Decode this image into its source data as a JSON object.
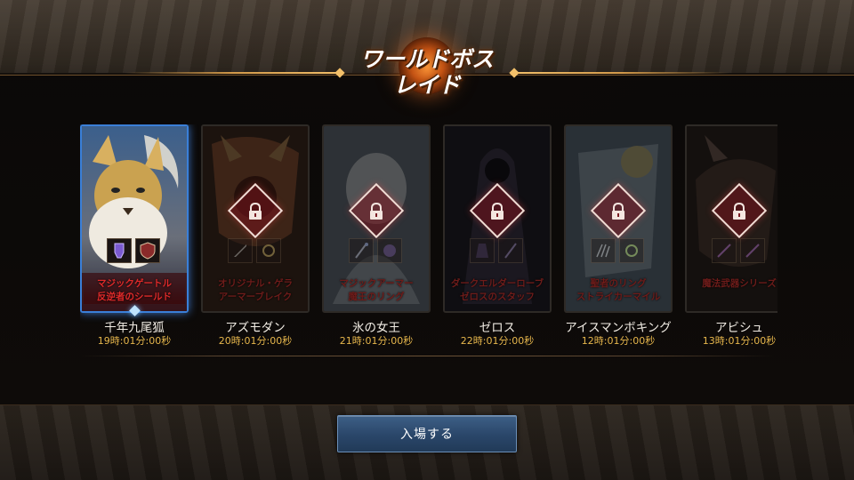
{
  "title": {
    "line1": "ワールドボス",
    "line2": "レイド"
  },
  "bosses": [
    {
      "name": "千年九尾狐",
      "time": "19時:01分:00秒",
      "reward_line1": "マジックゲートル",
      "reward_line2": "反逆者のシールド",
      "locked": false,
      "selected": true,
      "art_color": "#c9a45a",
      "slot_icons": [
        "gauntlet-icon",
        "shield-icon"
      ]
    },
    {
      "name": "アズモダン",
      "time": "20時:01分:00秒",
      "reward_line1": "オリジナル・ゲラ",
      "reward_line2": "アーマーブレイク",
      "locked": true,
      "selected": false,
      "art_color": "#b0502a",
      "slot_icons": [
        "sword-icon",
        "ring-icon"
      ]
    },
    {
      "name": "氷の女王",
      "time": "21時:01分:00秒",
      "reward_line1": "マジックアーマー",
      "reward_line2": "魔王のリング",
      "locked": true,
      "selected": false,
      "art_color": "#9aa9b8",
      "slot_icons": [
        "staff-icon",
        "orb-icon"
      ]
    },
    {
      "name": "ゼロス",
      "time": "22時:01分:00秒",
      "reward_line1": "ダークエルダーローブ",
      "reward_line2": "ゼロスのスタッフ",
      "locked": true,
      "selected": false,
      "art_color": "#4d3f5c",
      "slot_icons": [
        "robe-icon",
        "staff-icon"
      ]
    },
    {
      "name": "アイスマンボキング",
      "time": "12時:01分:00秒",
      "reward_line1": "聖者のリング",
      "reward_line2": "ストライカーマイル",
      "locked": true,
      "selected": false,
      "art_color": "#8aa7c0",
      "slot_icons": [
        "claw-icon",
        "ring-icon"
      ]
    },
    {
      "name": "アビシュ",
      "time": "13時:01分:00秒",
      "reward_line1": "魔法武器シリーズ",
      "reward_line2": "",
      "locked": true,
      "selected": false,
      "art_color": "#7a5a4a",
      "slot_icons": [
        "spear-icon",
        "spear-icon"
      ]
    }
  ],
  "enter_button": {
    "label": "入場する"
  },
  "colors": {
    "accent_gold": "#e6b64c",
    "reward_red": "#e02a2a",
    "selected_border": "#3a7fd8",
    "button_blue": "#2a4669"
  }
}
